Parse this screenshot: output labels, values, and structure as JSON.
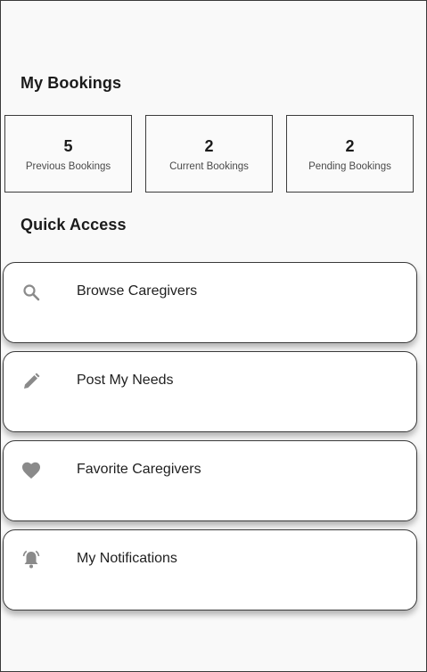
{
  "bookings": {
    "title": "My Bookings",
    "stats": [
      {
        "value": "5",
        "label": "Previous Bookings"
      },
      {
        "value": "2",
        "label": "Current Bookings"
      },
      {
        "value": "2",
        "label": "Pending Bookings"
      }
    ]
  },
  "quick_access": {
    "title": "Quick Access",
    "items": [
      {
        "label": "Browse Caregivers",
        "icon": "search-icon"
      },
      {
        "label": "Post My Needs",
        "icon": "pencil-icon"
      },
      {
        "label": "Favorite Caregivers",
        "icon": "heart-icon"
      },
      {
        "label": "My Notifications",
        "icon": "bell-icon"
      }
    ]
  },
  "colors": {
    "icon": "#8a8a8a",
    "text": "#1b1b1b",
    "border": "#3a3a3a"
  }
}
